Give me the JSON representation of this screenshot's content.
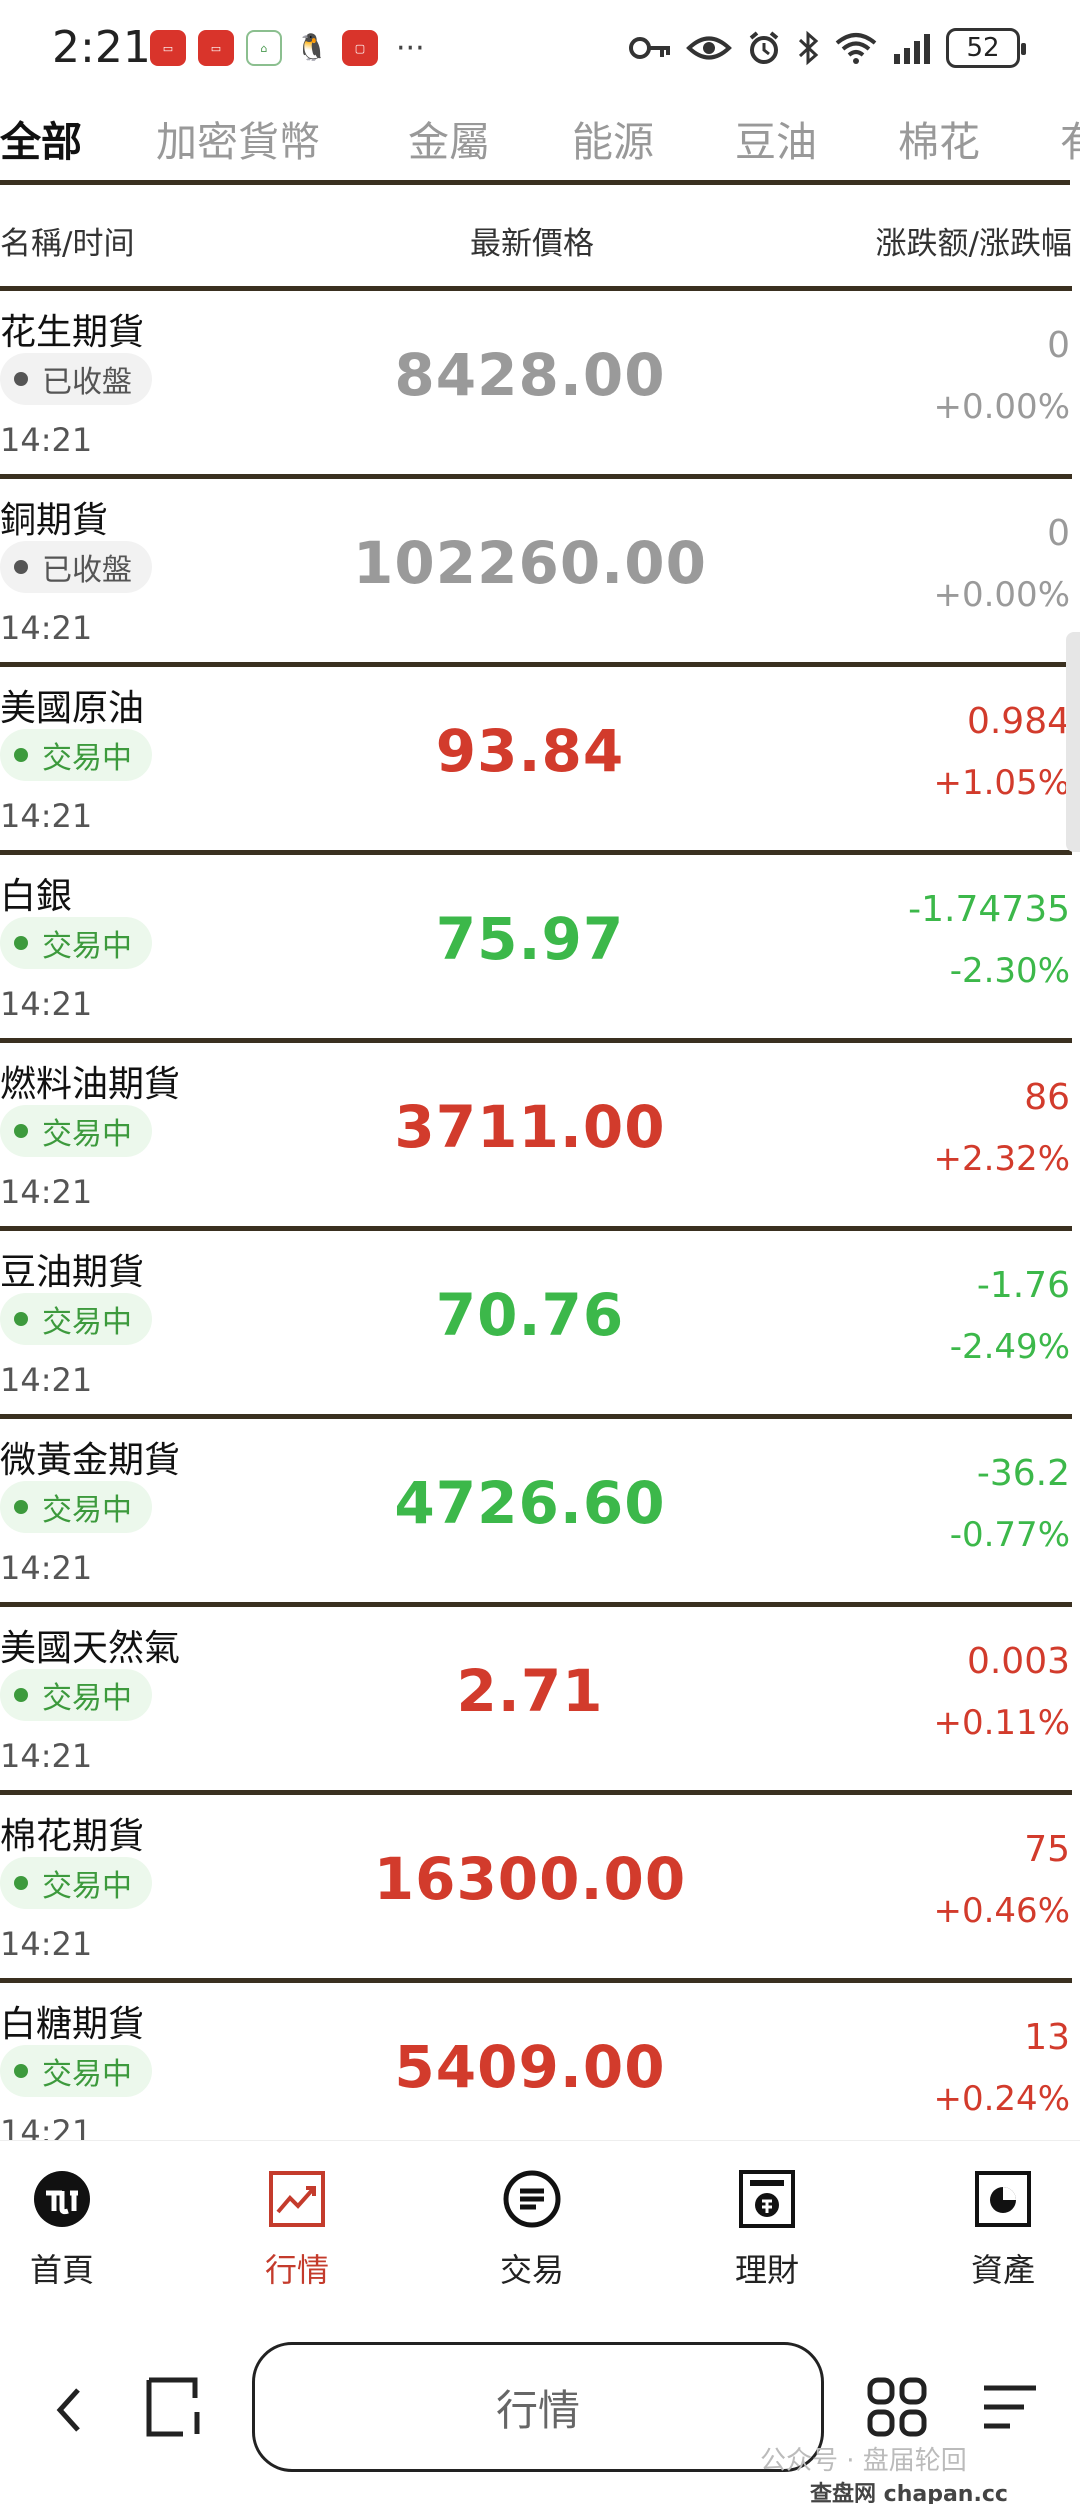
{
  "status_bar": {
    "time": "2:21",
    "battery": "52",
    "more": "···"
  },
  "tabs": [
    {
      "label": "全部",
      "active": true
    },
    {
      "label": "加密貨幣",
      "active": false
    },
    {
      "label": "金屬",
      "active": false
    },
    {
      "label": "能源",
      "active": false
    },
    {
      "label": "豆油",
      "active": false
    },
    {
      "label": "棉花",
      "active": false
    },
    {
      "label": "有",
      "active": false
    }
  ],
  "columns": {
    "name": "名稱/时间",
    "price": "最新價格",
    "change": "涨跌额/涨跌幅"
  },
  "rows": [
    {
      "name": "花生期貨",
      "status": "已收盤",
      "time": "14:21",
      "price": "8428.00",
      "change": "0",
      "pct": "+0.00%",
      "trend": "gray",
      "trading": false
    },
    {
      "name": "銅期貨",
      "status": "已收盤",
      "time": "14:21",
      "price": "102260.00",
      "change": "0",
      "pct": "+0.00%",
      "trend": "gray",
      "trading": false
    },
    {
      "name": "美國原油",
      "status": "交易中",
      "time": "14:21",
      "price": "93.84",
      "change": "0.984",
      "pct": "+1.05%",
      "trend": "red",
      "trading": true
    },
    {
      "name": "白銀",
      "status": "交易中",
      "time": "14:21",
      "price": "75.97",
      "change": "-1.74735",
      "pct": "-2.30%",
      "trend": "green",
      "trading": true
    },
    {
      "name": "燃料油期貨",
      "status": "交易中",
      "time": "14:21",
      "price": "3711.00",
      "change": "86",
      "pct": "+2.32%",
      "trend": "red",
      "trading": true
    },
    {
      "name": "豆油期貨",
      "status": "交易中",
      "time": "14:21",
      "price": "70.76",
      "change": "-1.76",
      "pct": "-2.49%",
      "trend": "green",
      "trading": true
    },
    {
      "name": "微黃金期貨",
      "status": "交易中",
      "time": "14:21",
      "price": "4726.60",
      "change": "-36.2",
      "pct": "-0.77%",
      "trend": "green",
      "trading": true
    },
    {
      "name": "美國天然氣",
      "status": "交易中",
      "time": "14:21",
      "price": "2.71",
      "change": "0.003",
      "pct": "+0.11%",
      "trend": "red",
      "trading": true
    },
    {
      "name": "棉花期貨",
      "status": "交易中",
      "time": "14:21",
      "price": "16300.00",
      "change": "75",
      "pct": "+0.46%",
      "trend": "red",
      "trading": true
    },
    {
      "name": "白糖期貨",
      "status": "交易中",
      "time": "14:21",
      "price": "5409.00",
      "change": "13",
      "pct": "+0.24%",
      "trend": "red",
      "trading": true
    }
  ],
  "bottom_nav": [
    {
      "label": "首頁",
      "icon": "home-logo-icon",
      "active": false
    },
    {
      "label": "行情",
      "icon": "market-chart-icon",
      "active": true
    },
    {
      "label": "交易",
      "icon": "trade-list-icon",
      "active": false
    },
    {
      "label": "理財",
      "icon": "finance-icon",
      "active": false
    },
    {
      "label": "資產",
      "icon": "assets-pie-icon",
      "active": false
    }
  ],
  "system_nav": {
    "pill_label": "行情",
    "watermark": "公众号 · 盘届轮回",
    "watermark_site": "查盘网 chapan.cc"
  },
  "colors": {
    "red": "#d23b2c",
    "green": "#3cb84a",
    "gray": "#9a9a9a",
    "divider": "#3a3020",
    "active_nav": "#c43b2c"
  }
}
